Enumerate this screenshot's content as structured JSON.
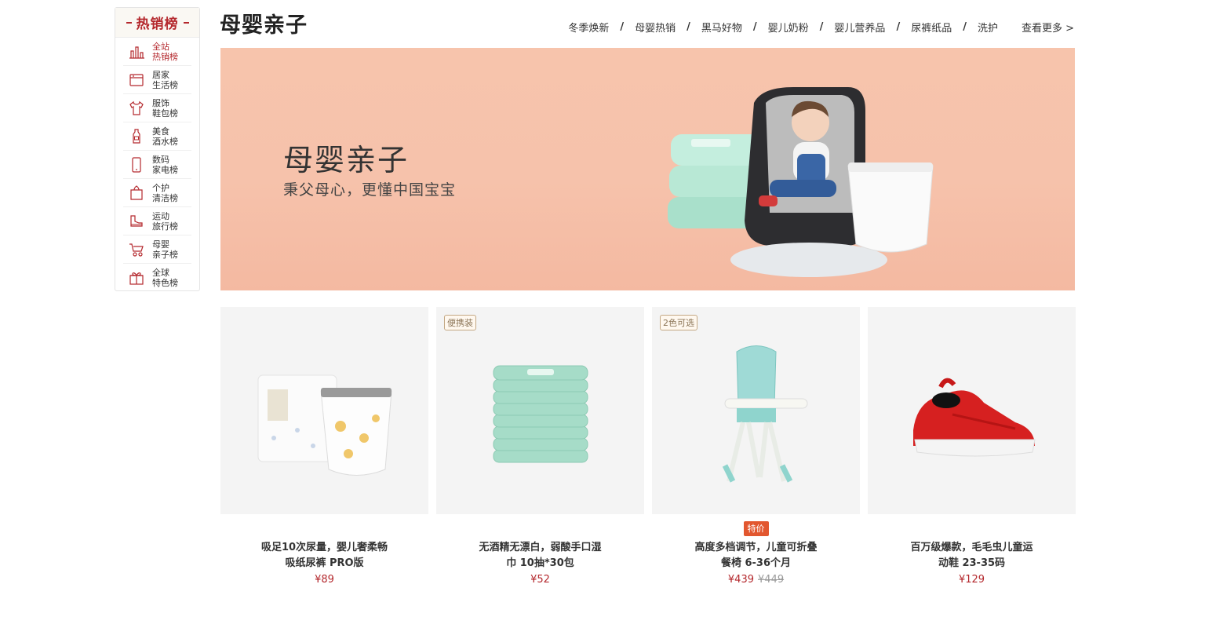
{
  "sidebar": {
    "title": "热销榜",
    "items": [
      {
        "line1": "全站",
        "line2": "热销榜",
        "icon": "bar-chart-icon",
        "active": true
      },
      {
        "line1": "居家",
        "line2": "生活榜",
        "icon": "appliance-icon",
        "active": false
      },
      {
        "line1": "服饰",
        "line2": "鞋包榜",
        "icon": "shirt-icon",
        "active": false
      },
      {
        "line1": "美食",
        "line2": "酒水榜",
        "icon": "bottle-icon",
        "active": false
      },
      {
        "line1": "数码",
        "line2": "家电榜",
        "icon": "phone-icon",
        "active": false
      },
      {
        "line1": "个护",
        "line2": "清洁榜",
        "icon": "tissue-icon",
        "active": false
      },
      {
        "line1": "运动",
        "line2": "旅行榜",
        "icon": "shoe-icon",
        "active": false
      },
      {
        "line1": "母婴",
        "line2": "亲子榜",
        "icon": "stroller-icon",
        "active": false
      },
      {
        "line1": "全球",
        "line2": "特色榜",
        "icon": "gift-icon",
        "active": false
      }
    ]
  },
  "header": {
    "title": "母婴亲子",
    "nav": [
      "冬季焕新",
      "母婴热销",
      "黑马好物",
      "婴儿奶粉",
      "婴儿营养品",
      "尿裤纸品",
      "洗护"
    ],
    "separator": "/",
    "more": "查看更多 >"
  },
  "banner": {
    "title": "母婴亲子",
    "subtitle": "秉父母心，更懂中国宝宝"
  },
  "products": [
    {
      "tag": "",
      "promo": "",
      "name_line1": "吸足10次尿量，婴儿奢柔畅",
      "name_line2": "吸纸尿裤 PRO版",
      "price": "¥89",
      "original_price": "",
      "icon": "diaper-icon"
    },
    {
      "tag": "便携装",
      "promo": "",
      "name_line1": "无酒精无漂白，弱酸手口湿",
      "name_line2": "巾 10抽*30包",
      "price": "¥52",
      "original_price": "",
      "icon": "wipes-icon"
    },
    {
      "tag": "2色可选",
      "promo": "特价",
      "name_line1": "高度多档调节，儿童可折叠",
      "name_line2": "餐椅 6-36个月",
      "price": "¥439",
      "original_price": "¥449",
      "icon": "high-chair-icon"
    },
    {
      "tag": "",
      "promo": "",
      "name_line1": "百万级爆款，毛毛虫儿童运",
      "name_line2": "动鞋 23-35码",
      "price": "¥129",
      "original_price": "",
      "icon": "kids-shoe-icon"
    }
  ],
  "colors": {
    "accent": "#b4282d",
    "promo": "#e2572f",
    "banner": "#f7c4ac"
  }
}
